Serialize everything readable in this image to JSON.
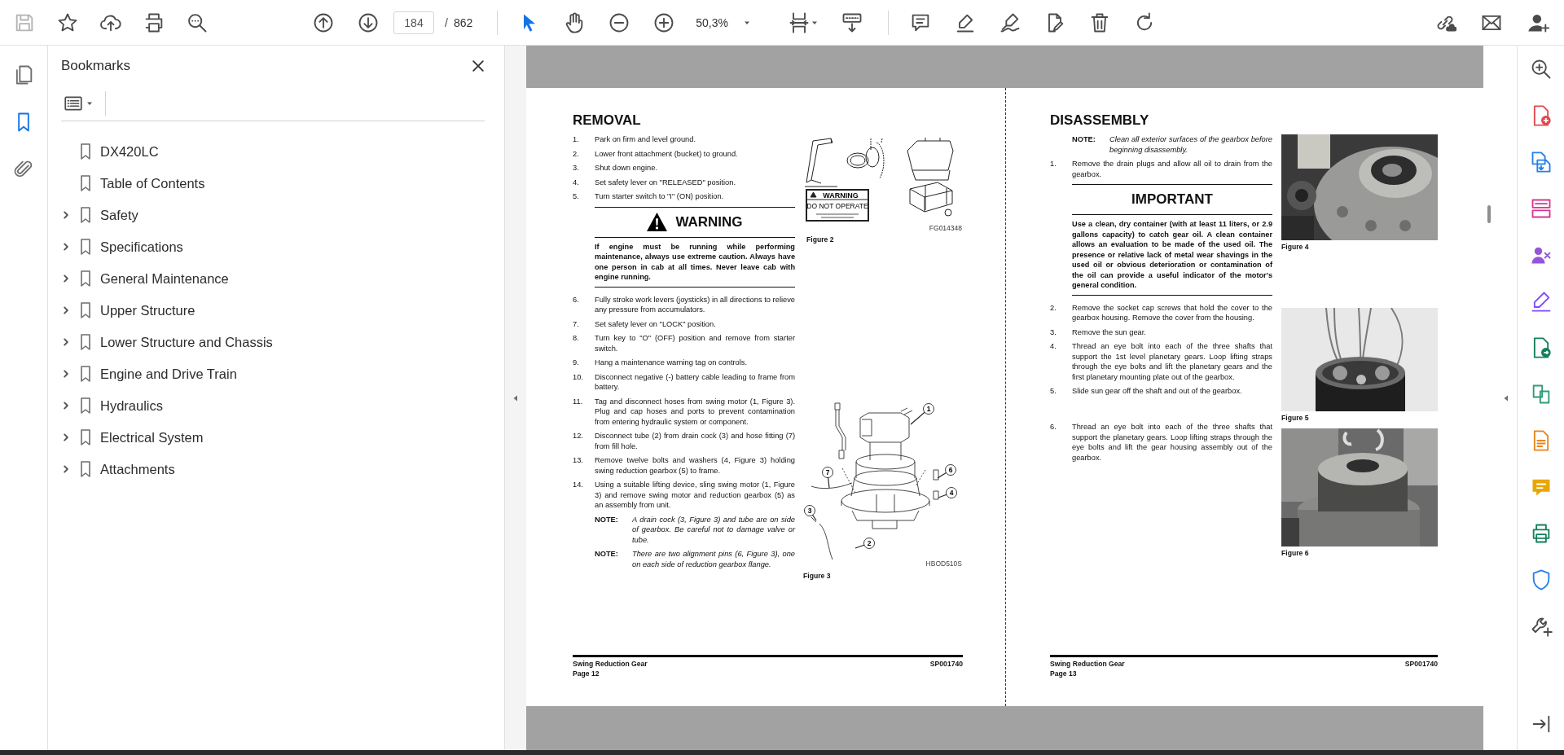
{
  "toolbar": {
    "save_disabled": true,
    "page_number": "184",
    "page_separator": "/",
    "page_total": "862",
    "zoom": "50,3%"
  },
  "left_rail": [
    {
      "kind": "pages",
      "selected": false
    },
    {
      "kind": "bookmarks",
      "selected": true
    },
    {
      "kind": "attachments",
      "selected": false
    }
  ],
  "bookmarks": {
    "title": "Bookmarks",
    "items": [
      {
        "label": "DX420LC",
        "kind": "leaf"
      },
      {
        "label": "Table of Contents",
        "kind": "leaf"
      },
      {
        "label": "Safety",
        "kind": "branch",
        "expanded": false
      },
      {
        "label": "Specifications",
        "kind": "branch",
        "expanded": false
      },
      {
        "label": "General Maintenance",
        "kind": "branch",
        "expanded": false
      },
      {
        "label": "Upper Structure",
        "kind": "branch",
        "expanded": false
      },
      {
        "label": "Lower Structure and Chassis",
        "kind": "branch",
        "expanded": false
      },
      {
        "label": "Engine and Drive Train",
        "kind": "branch",
        "expanded": false
      },
      {
        "label": "Hydraulics",
        "kind": "branch",
        "expanded": false
      },
      {
        "label": "Electrical System",
        "kind": "branch",
        "expanded": false
      },
      {
        "label": "Attachments",
        "kind": "branch",
        "expanded": false
      }
    ]
  },
  "pages": [
    {
      "heading": "REMOVAL",
      "rows": [
        {
          "blocks": [
            {
              "kind": "step",
              "number": "1.",
              "text": "Park on firm and level ground."
            },
            {
              "kind": "step",
              "number": "2.",
              "text": "Lower front attachment (bucket) to ground."
            },
            {
              "kind": "step",
              "number": "3.",
              "text": "Shut down engine."
            },
            {
              "kind": "step",
              "number": "4.",
              "text": "Set safety lever on \"RELEASED\" position."
            },
            {
              "kind": "step",
              "number": "5.",
              "text": "Turn starter switch to \"I\" (ON) position."
            },
            {
              "kind": "warning",
              "title": "WARNING",
              "text": "If engine must be running while performing maintenance, always use extreme caution. Always have one person in cab at all times. Never leave cab with engine running."
            },
            {
              "kind": "step",
              "number": "6.",
              "text": "Fully stroke work levers (joysticks) in all directions to relieve any pressure from accumulators."
            },
            {
              "kind": "step",
              "number": "7.",
              "text": "Set safety lever on \"LOCK\" position."
            },
            {
              "kind": "step",
              "number": "8.",
              "text": "Turn key to \"O\" (OFF) position and remove from starter switch."
            },
            {
              "kind": "step",
              "number": "9.",
              "text": "Hang a maintenance warning tag on controls."
            },
            {
              "kind": "step",
              "number": "10.",
              "text": "Disconnect negative (-) battery cable leading to frame from battery."
            }
          ],
          "figures": [
            {
              "kind": "parts_drawing",
              "caption": "Figure 2",
              "code": "FG014348",
              "sign_title": "WARNING",
              "sign_text": "DO NOT OPERATE"
            }
          ]
        },
        {
          "blocks": [
            {
              "kind": "step",
              "number": "11.",
              "text": "Tag and disconnect hoses from swing motor (1, Figure 3). Plug and cap hoses and ports to prevent contamination from entering hydraulic system or component."
            },
            {
              "kind": "step",
              "number": "12.",
              "text": "Disconnect tube (2) from drain cock (3) and hose fitting (7) from fill hole."
            },
            {
              "kind": "step",
              "number": "13.",
              "text": "Remove twelve bolts and washers (4, Figure 3) holding swing reduction gearbox (5) to frame."
            },
            {
              "kind": "step",
              "number": "14.",
              "text": "Using a suitable lifting device, sling swing motor (1, Figure 3) and remove swing motor and reduction gearbox (5) as an assembly from unit."
            },
            {
              "kind": "note",
              "label": "NOTE:",
              "text": "A drain cock (3, Figure 3) and tube are on side of gearbox. Be careful not to damage valve or tube."
            },
            {
              "kind": "note",
              "label": "NOTE:",
              "text": "There are two alignment pins (6, Figure 3), one on each side of reduction gearbox flange."
            }
          ],
          "figures": [
            {
              "kind": "motor_drawing",
              "caption": "Figure 3",
              "code": "HBOD510S",
              "callouts": [
                "1",
                "2",
                "3",
                "4",
                "6",
                "7"
              ]
            }
          ]
        }
      ],
      "footer": {
        "title": "Swing Reduction Gear",
        "code": "SP001740",
        "page": "Page 12"
      }
    },
    {
      "heading": "DISASSEMBLY",
      "rows": [
        {
          "blocks": [
            {
              "kind": "note",
              "label": "NOTE:",
              "text": "Clean all exterior surfaces of the gearbox before beginning disassembly."
            },
            {
              "kind": "step",
              "number": "1.",
              "text": "Remove the drain plugs and allow all oil to drain from the gearbox."
            },
            {
              "kind": "important",
              "title": "IMPORTANT",
              "text": "Use a clean, dry container (with at least 11 liters, or 2.9 gallons capacity) to catch gear oil. A clean container allows an evaluation to be made of the used oil. The presence or relative lack of metal wear shavings in the used oil or obvious deterioration or contamination of the oil can provide a useful indicator of the motor's general condition."
            },
            {
              "kind": "step",
              "number": "2.",
              "text": "Remove the socket cap screws that hold the cover to the gearbox housing. Remove the cover from the housing."
            },
            {
              "kind": "step",
              "number": "3.",
              "text": "Remove the sun gear."
            },
            {
              "kind": "step",
              "number": "4.",
              "text": "Thread an eye bolt into each of the three shafts that support the 1st level planetary gears. Loop lifting straps through the eye bolts and lift the planetary gears and the first planetary mounting plate out of the gearbox."
            },
            {
              "kind": "step",
              "number": "5.",
              "text": "Slide sun gear off the shaft and out of the gearbox."
            }
          ],
          "figures": [
            {
              "caption": "Figure 4"
            },
            {
              "caption": "Figure 5"
            }
          ]
        },
        {
          "blocks": [
            {
              "kind": "step",
              "number": "6.",
              "text": "Thread an eye bolt into each of the three shafts that support the planetary gears. Loop lifting straps through the eye bolts and lift the gear housing assembly out of the gearbox."
            }
          ],
          "figures": [
            {
              "caption": "Figure 6"
            }
          ]
        }
      ],
      "footer": {
        "title": "Swing Reduction Gear",
        "code": "SP001740",
        "page": "Page 13"
      }
    }
  ]
}
